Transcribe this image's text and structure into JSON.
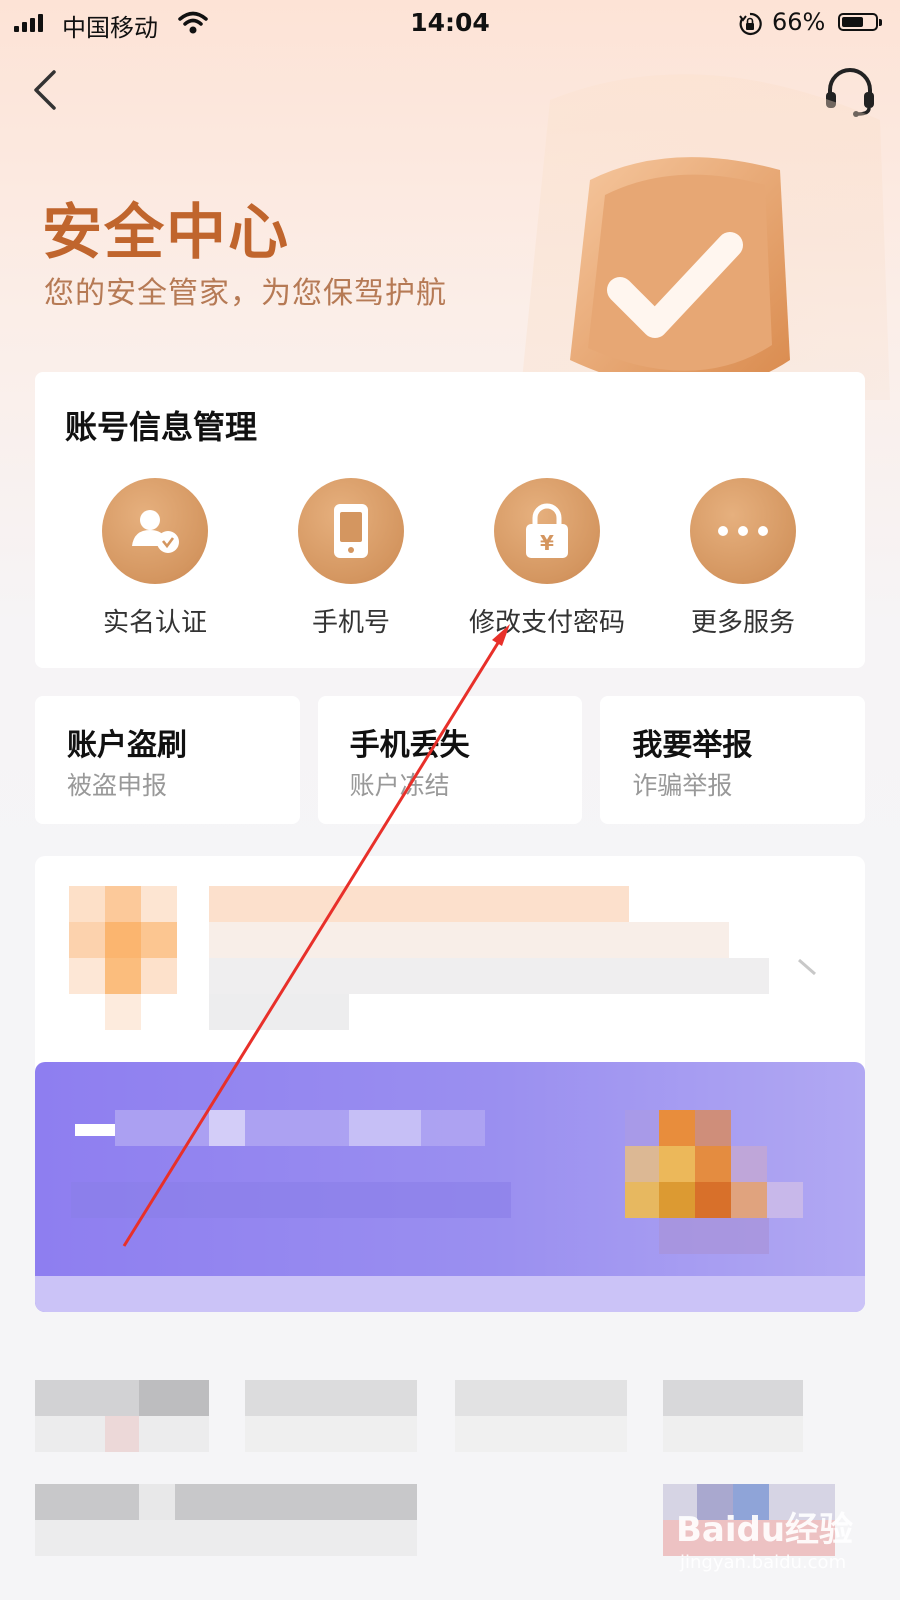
{
  "status_bar": {
    "carrier": "中国移动",
    "time": "14:04",
    "battery_percent": "66%",
    "battery_level": 0.66
  },
  "header": {
    "back_icon": "chevron-left-icon",
    "support_icon": "headset-icon"
  },
  "hero": {
    "title": "安全中心",
    "subtitle": "您的安全管家，为您保驾护航"
  },
  "account_card": {
    "title": "账号信息管理",
    "services": [
      {
        "label": "实名认证",
        "icon": "user-verified-icon"
      },
      {
        "label": "手机号",
        "icon": "phone-icon"
      },
      {
        "label": "修改支付密码",
        "icon": "lock-yuan-icon"
      },
      {
        "label": "更多服务",
        "icon": "more-dots-icon"
      }
    ]
  },
  "quick_actions": [
    {
      "title": "账户盗刷",
      "subtitle": "被盗申报"
    },
    {
      "title": "手机丢失",
      "subtitle": "账户冻结"
    },
    {
      "title": "我要举报",
      "subtitle": "诈骗举报"
    }
  ],
  "watermark": {
    "logo": "Baidu经验",
    "url": "jingyan.baidu.com"
  },
  "colors": {
    "accent": "#c0652d",
    "service_circle": "#d49660",
    "banner": "#8e7ef0",
    "annotation_arrow": "#e8302a"
  }
}
